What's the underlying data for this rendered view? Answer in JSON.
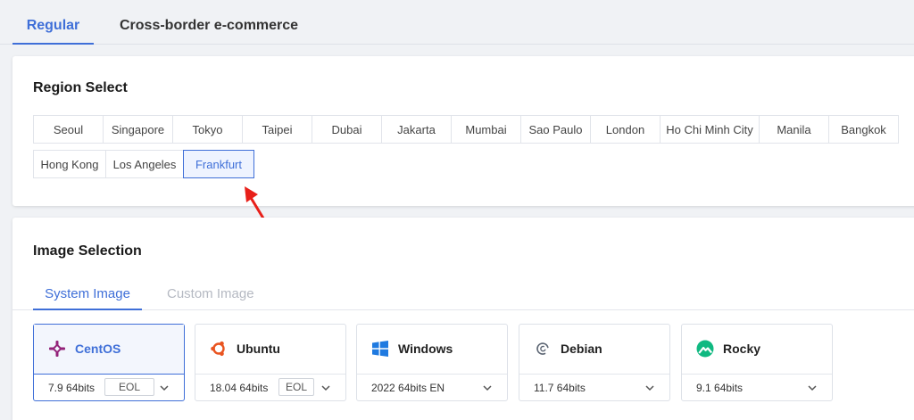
{
  "top_tabs": [
    {
      "label": "Regular",
      "active": true
    },
    {
      "label": "Cross-border e-commerce",
      "active": false
    }
  ],
  "region_section": {
    "title": "Region Select",
    "rows": [
      [
        "Seoul",
        "Singapore",
        "Tokyo",
        "Taipei",
        "Dubai",
        "Jakarta",
        "Mumbai",
        "Sao Paulo",
        "London",
        "Ho Chi Minh City",
        "Manila",
        "Bangkok"
      ],
      [
        "Hong Kong",
        "Los Angeles",
        "Frankfurt"
      ]
    ],
    "selected": "Frankfurt"
  },
  "image_section": {
    "title": "Image Selection",
    "tabs": [
      {
        "label": "System Image",
        "active": true
      },
      {
        "label": "Custom Image",
        "active": false
      }
    ],
    "os_options": [
      {
        "name": "CentOS",
        "icon": "centos-icon",
        "version": "7.9 64bits",
        "badge": "EOL",
        "selected": true
      },
      {
        "name": "Ubuntu",
        "icon": "ubuntu-icon",
        "version": "18.04 64bits",
        "badge": "EOL",
        "selected": false
      },
      {
        "name": "Windows",
        "icon": "windows-icon",
        "version": "2022 64bits EN",
        "badge": "",
        "selected": false
      },
      {
        "name": "Debian",
        "icon": "debian-icon",
        "version": "11.7 64bits",
        "badge": "",
        "selected": false
      },
      {
        "name": "Rocky",
        "icon": "rocky-icon",
        "version": "9.1 64bits",
        "badge": "",
        "selected": false
      }
    ]
  },
  "colors": {
    "accent": "#3f6fd8",
    "annotation_arrow": "#e8201a",
    "centos": "#932279",
    "ubuntu": "#e95420",
    "windows": "#1f7ae0",
    "rocky": "#10b981"
  }
}
